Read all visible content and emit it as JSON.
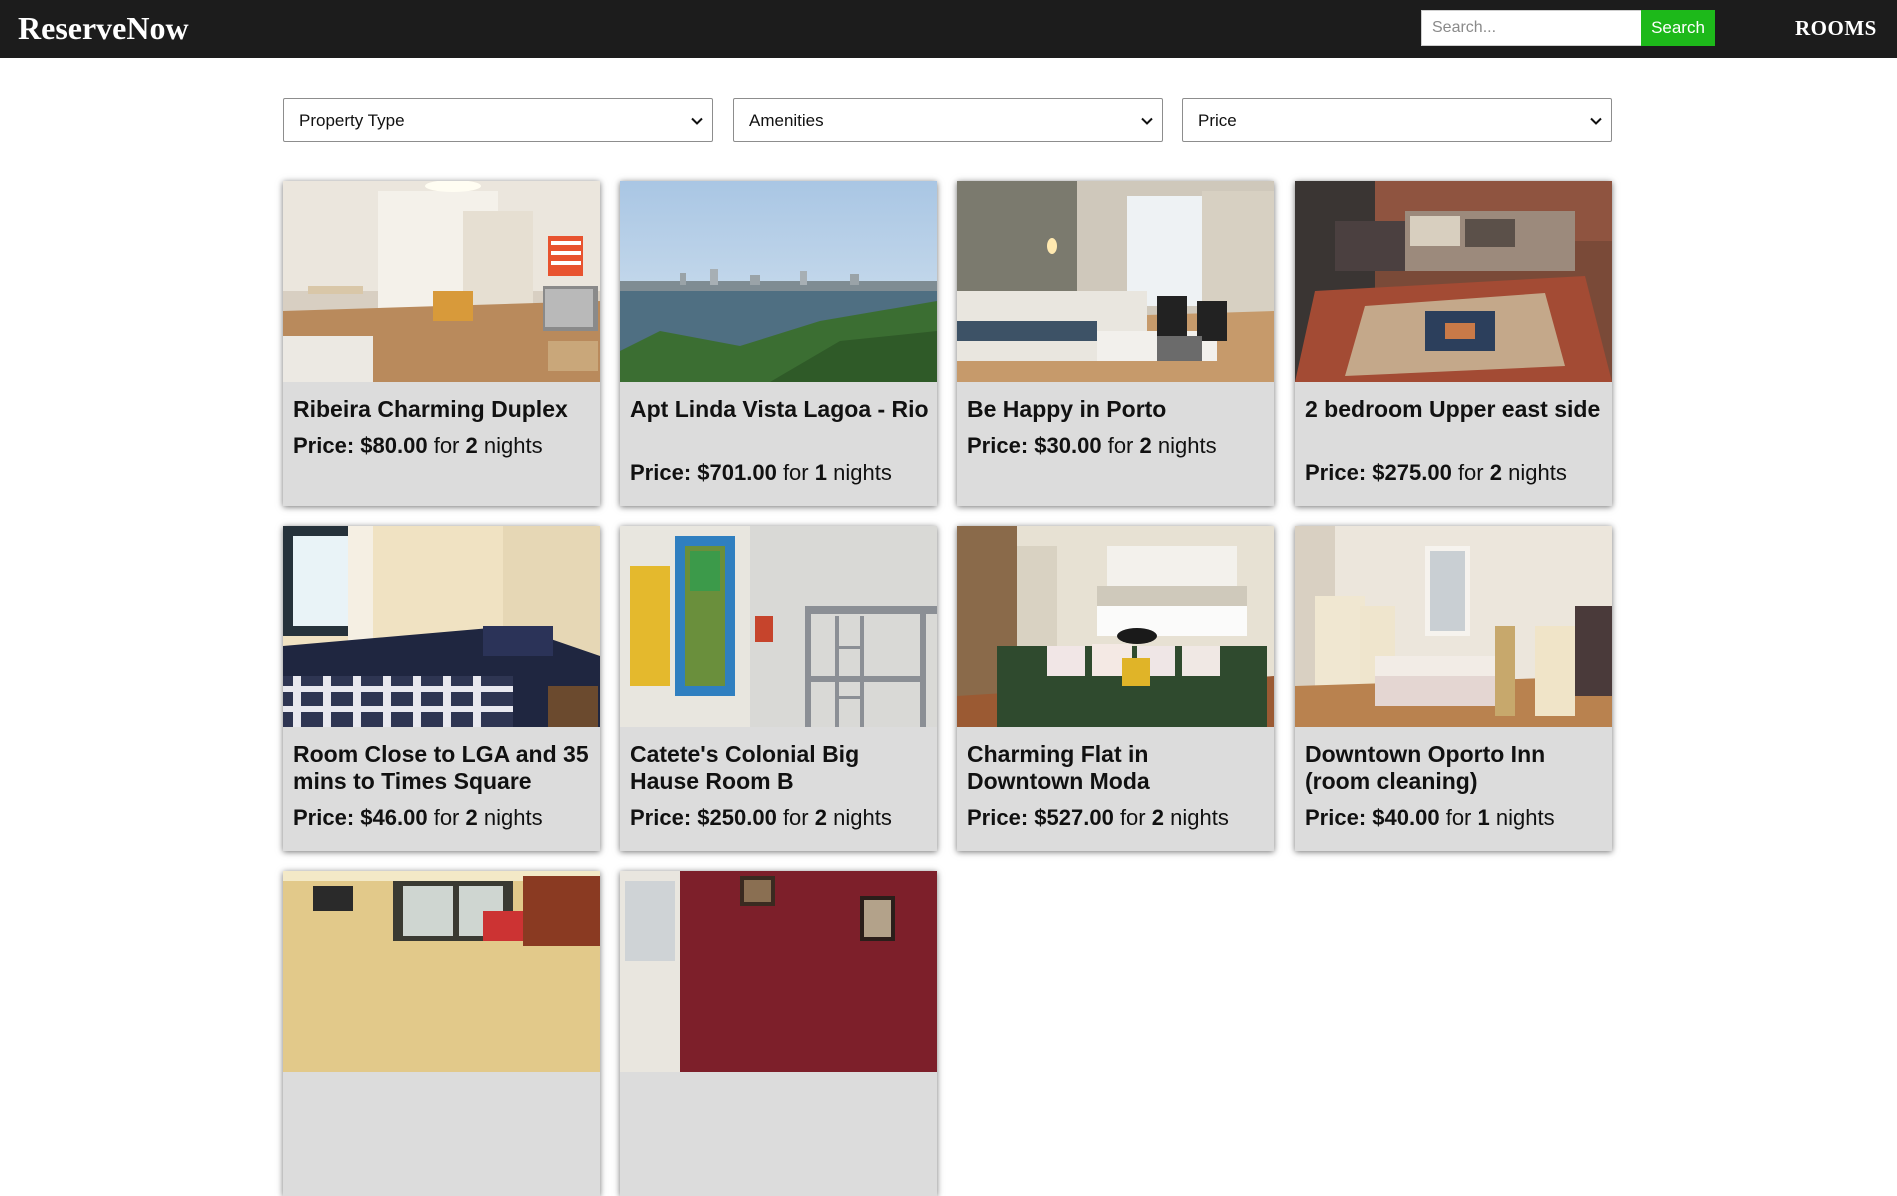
{
  "app": {
    "brand": "ReserveNow",
    "nav_link": "ROOMS"
  },
  "search": {
    "placeholder": "Search...",
    "button_label": "Search"
  },
  "filters": [
    {
      "label": "Property Type"
    },
    {
      "label": "Amenities"
    },
    {
      "label": "Price"
    }
  ],
  "listings": [
    {
      "title": "Ribeira Charming Duplex",
      "price_label": "Price:",
      "price": "$80.00",
      "for": "for",
      "nights": "2",
      "nights_label": "nights"
    },
    {
      "title": "Apt Linda Vista Lagoa - Rio",
      "price_label": "Price:",
      "price": "$701.00",
      "for": "for",
      "nights": "1",
      "nights_label": "nights"
    },
    {
      "title": "Be Happy in Porto",
      "price_label": "Price:",
      "price": "$30.00",
      "for": "for",
      "nights": "2",
      "nights_label": "nights"
    },
    {
      "title": "2 bedroom Upper east side",
      "price_label": "Price:",
      "price": "$275.00",
      "for": "for",
      "nights": "2",
      "nights_label": "nights"
    },
    {
      "title": "Room Close to LGA and 35 mins to Times Square",
      "price_label": "Price:",
      "price": "$46.00",
      "for": "for",
      "nights": "2",
      "nights_label": "nights"
    },
    {
      "title": "Catete's Colonial Big Hause Room B",
      "price_label": "Price:",
      "price": "$250.00",
      "for": "for",
      "nights": "2",
      "nights_label": "nights"
    },
    {
      "title": "Charming Flat in Downtown Moda",
      "price_label": "Price:",
      "price": "$527.00",
      "for": "for",
      "nights": "2",
      "nights_label": "nights"
    },
    {
      "title": "Downtown Oporto Inn (room cleaning)",
      "price_label": "Price:",
      "price": "$40.00",
      "for": "for",
      "nights": "1",
      "nights_label": "nights"
    }
  ],
  "colors": {
    "navbar": "#1c1c1c",
    "search_button": "#1db91a",
    "card_background": "#dcdcdc"
  }
}
